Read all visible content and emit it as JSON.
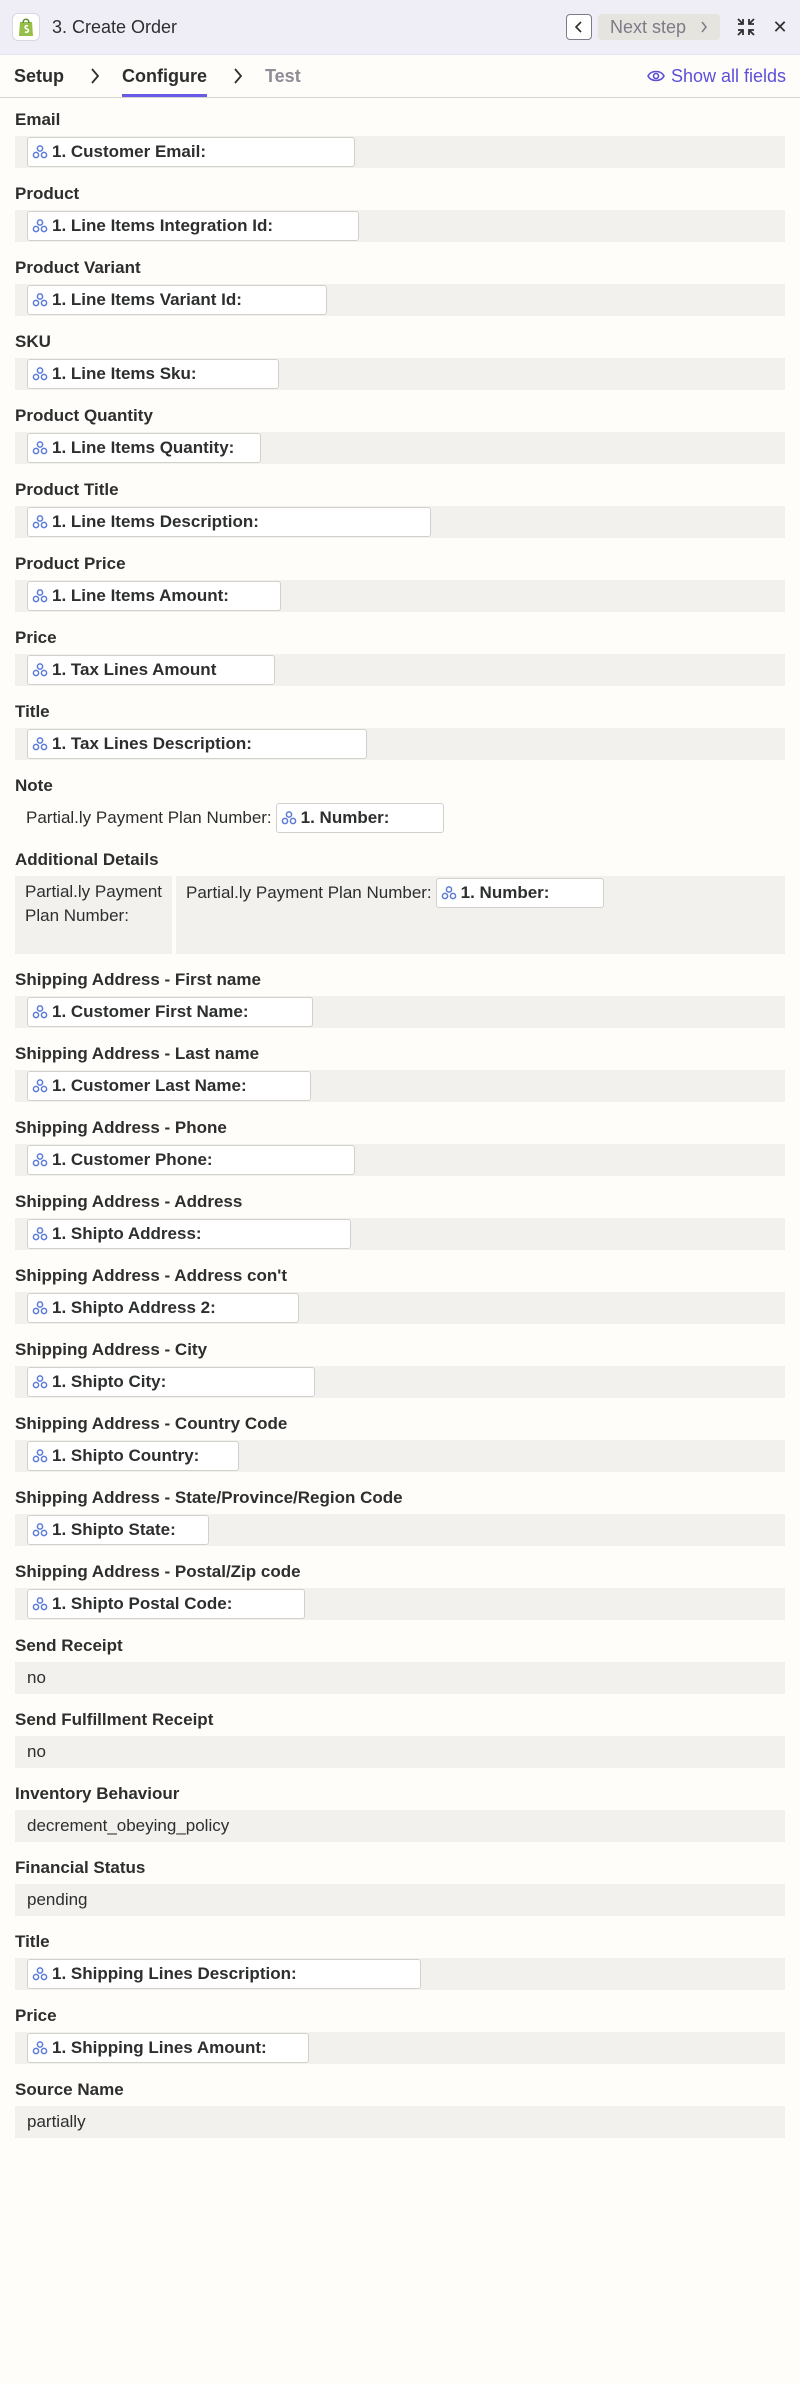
{
  "header": {
    "step_title": "3. Create Order",
    "next_step_label": "Next step"
  },
  "tabs": [
    {
      "label": "Setup"
    },
    {
      "label": "Configure"
    },
    {
      "label": "Test"
    }
  ],
  "show_all_label": "Show all fields",
  "fields": {
    "email": {
      "label": "Email",
      "value": "1. Customer Email:"
    },
    "product": {
      "label": "Product",
      "value": "1. Line Items Integration Id:"
    },
    "product_variant": {
      "label": "Product Variant",
      "value": "1. Line Items Variant Id:"
    },
    "sku": {
      "label": "SKU",
      "value": "1. Line Items Sku:"
    },
    "product_quantity": {
      "label": "Product Quantity",
      "value": "1. Line Items Quantity:"
    },
    "product_title": {
      "label": "Product Title",
      "value": "1. Line Items Description:"
    },
    "product_price": {
      "label": "Product Price",
      "value": "1. Line Items Amount:"
    },
    "price": {
      "label": "Price",
      "value": "1. Tax Lines Amount"
    },
    "title": {
      "label": "Title",
      "value": "1. Tax Lines Description:"
    },
    "note": {
      "label": "Note",
      "prefix": "Partial.ly Payment Plan Number:",
      "value": "1. Number:"
    },
    "additional_details": {
      "label": "Additional Details",
      "key": "Partial.ly Payment Plan Number:",
      "prefix": "Partial.ly Payment Plan Number:",
      "value": "1. Number:"
    },
    "ship_first": {
      "label": "Shipping Address - First name",
      "value": "1. Customer First Name:"
    },
    "ship_last": {
      "label": "Shipping Address - Last name",
      "value": "1. Customer Last Name:"
    },
    "ship_phone": {
      "label": "Shipping Address - Phone",
      "value": "1. Customer Phone:"
    },
    "ship_address": {
      "label": "Shipping Address - Address",
      "value": "1. Shipto Address:"
    },
    "ship_address2": {
      "label": "Shipping Address - Address con't",
      "value": "1. Shipto Address 2:"
    },
    "ship_city": {
      "label": "Shipping Address - City",
      "value": "1. Shipto City:"
    },
    "ship_country": {
      "label": "Shipping Address - Country Code",
      "value": "1. Shipto Country:"
    },
    "ship_state": {
      "label": "Shipping Address - State/Province/Region Code",
      "value": "1. Shipto State:"
    },
    "ship_zip": {
      "label": "Shipping Address - Postal/Zip code",
      "value": "1. Shipto Postal Code:"
    },
    "send_receipt": {
      "label": "Send Receipt",
      "value": "no"
    },
    "send_fulfillment": {
      "label": "Send Fulfillment Receipt",
      "value": "no"
    },
    "inventory": {
      "label": "Inventory Behaviour",
      "value": "decrement_obeying_policy"
    },
    "financial": {
      "label": "Financial Status",
      "value": "pending"
    },
    "ship_title": {
      "label": "Title",
      "value": "1. Shipping Lines Description:"
    },
    "ship_price": {
      "label": "Price",
      "value": "1. Shipping Lines Amount:"
    },
    "source_name": {
      "label": "Source Name",
      "value": "partially"
    }
  },
  "colors": {
    "accent": "#695be8",
    "link": "#5b50d6",
    "header_bg": "#efeef7",
    "field_bg": "#f2f1ee",
    "shopify_green": "#95bf47"
  },
  "icons": {
    "app": "shopify-bag-icon",
    "pill": "webhook-icon",
    "show_all": "eye-icon"
  }
}
